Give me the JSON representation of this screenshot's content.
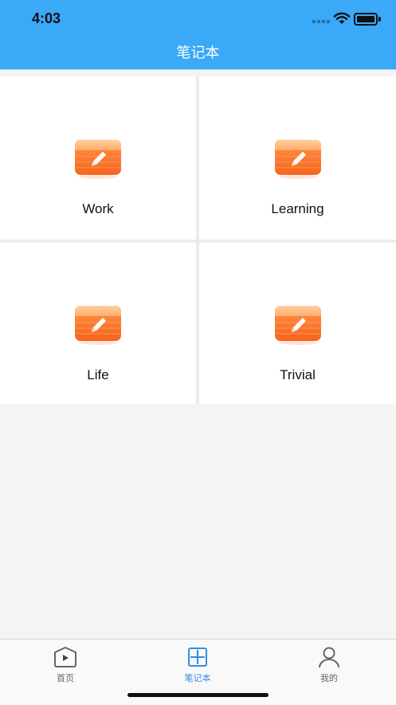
{
  "status_bar": {
    "time": "4:03",
    "battery_level": 1.0
  },
  "nav": {
    "title": "笔记本"
  },
  "notebooks": [
    {
      "label": "Work",
      "icon": "notebook-pencil-icon"
    },
    {
      "label": "Learning",
      "icon": "notebook-pencil-icon"
    },
    {
      "label": "Life",
      "icon": "notebook-pencil-icon"
    },
    {
      "label": "Trivial",
      "icon": "notebook-pencil-icon"
    }
  ],
  "tabbar": {
    "tabs": [
      {
        "label": "首页",
        "icon": "home-play-icon",
        "active": false
      },
      {
        "label": "笔记本",
        "icon": "plus-square-icon",
        "active": true
      },
      {
        "label": "我的",
        "icon": "user-icon",
        "active": false
      }
    ]
  },
  "colors": {
    "header": "#3aa9f7",
    "accent": "#2f8fe3",
    "notebook_orange": "#fa7a2e",
    "background": "#f4f4f4"
  }
}
